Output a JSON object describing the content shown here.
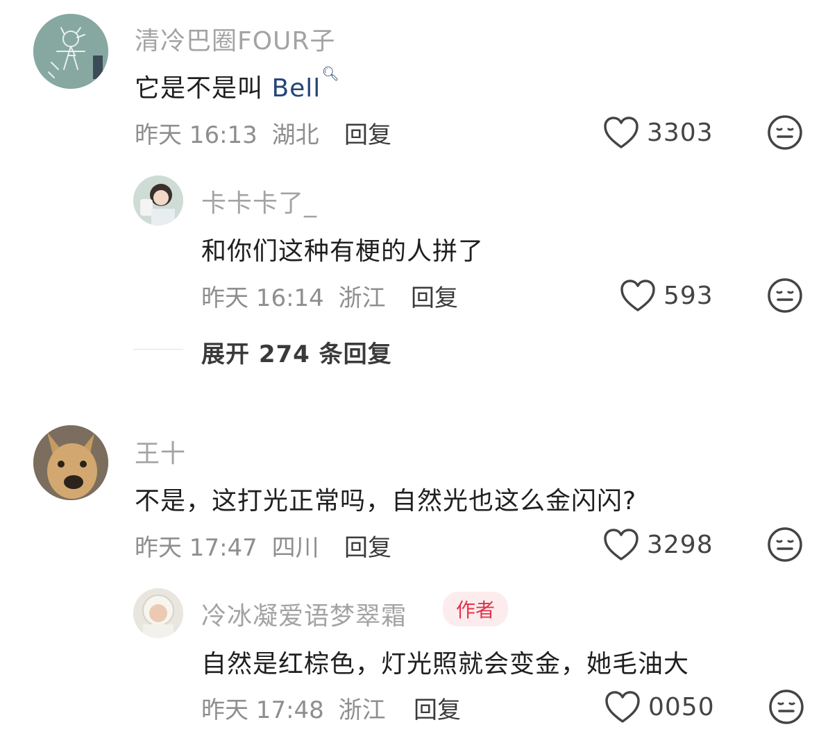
{
  "comments": [
    {
      "username": "清冷巴圈FOUR子",
      "text": "它是不是叫 ",
      "link": "Bell",
      "time": "昨天 16:13",
      "location": "湖北",
      "reply": "回复",
      "likes": "3303",
      "replies": [
        {
          "username": "卡卡卡了_",
          "text": "和你们这种有梗的人拼了",
          "time": "昨天 16:14",
          "location": "浙江",
          "reply": "回复",
          "likes": "593"
        }
      ],
      "expand": "展开 274 条回复"
    },
    {
      "username": "王十",
      "text": "不是，这打光正常吗，自然光也这么金闪闪?",
      "time": "昨天 17:47",
      "location": "四川",
      "reply": "回复",
      "likes": "3298",
      "replies": [
        {
          "username": "冷冰凝爱语梦翠霜",
          "badge": "作者",
          "text": "自然是红棕色，灯光照就会变金，她毛油大",
          "time": "昨天 17:48",
          "location": "浙江",
          "reply": "回复",
          "likes": "0050"
        }
      ]
    }
  ],
  "icons": {
    "like": "heart-outline-icon",
    "dislike": "meh-face-icon",
    "search": "search-icon"
  }
}
